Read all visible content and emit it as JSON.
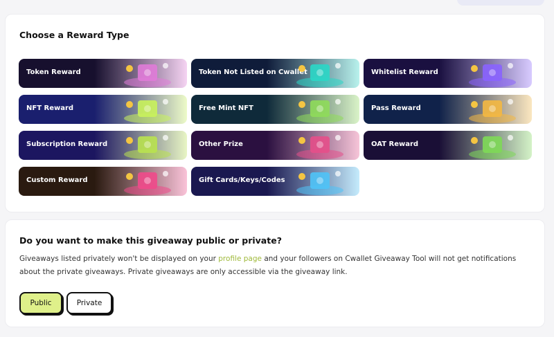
{
  "reward_section": {
    "title": "Choose a Reward Type",
    "tiles": [
      {
        "label": "Token Reward",
        "bg": "#17102e",
        "accent": "#e07bd8",
        "icon": "wallet-coins-icon"
      },
      {
        "label": "Token Not Listed on Cwallet",
        "bg": "#0f1c3a",
        "accent": "#2ad7c7",
        "icon": "coin-pedestal-icon"
      },
      {
        "label": "Whitelist Reward",
        "bg": "#1a1040",
        "accent": "#8a63ff",
        "icon": "astronaut-screen-icon"
      },
      {
        "label": "NFT Reward",
        "bg": "#1a1f6e",
        "accent": "#c9f25b",
        "icon": "nft-frame-icon"
      },
      {
        "label": "Free Mint NFT",
        "bg": "#0f2a3a",
        "accent": "#8fdc5a",
        "icon": "mint-coin-icon"
      },
      {
        "label": "Pass Reward",
        "bg": "#10224a",
        "accent": "#f4b841",
        "icon": "gift-box-icon"
      },
      {
        "label": "Subscription Reward",
        "bg": "#1c1660",
        "accent": "#b9e24f",
        "icon": "subscription-coins-icon"
      },
      {
        "label": "Other Prize",
        "bg": "#2b1040",
        "accent": "#e54f8a",
        "icon": "prize-box-icon"
      },
      {
        "label": "OAT Reward",
        "bg": "#1a0f36",
        "accent": "#7ed957",
        "icon": "oat-badge-icon"
      },
      {
        "label": "Custom Reward",
        "bg": "#2a1a10",
        "accent": "#ef4a8b",
        "icon": "custom-gift-icon"
      },
      {
        "label": "Gift Cards/Keys/Codes",
        "bg": "#1a1850",
        "accent": "#4fc3f7",
        "icon": "gift-cards-icon"
      }
    ]
  },
  "privacy_section": {
    "title": "Do you want to make this giveaway public or private?",
    "desc_before": "Giveaways listed privately won't be displayed on your ",
    "desc_link": "profile page",
    "desc_after": " and your followers on Cwallet Giveaway Tool will not get notifications about the private giveaways. Private giveaways are only accessible via the giveaway link.",
    "options": [
      {
        "label": "Public",
        "selected": true
      },
      {
        "label": "Private",
        "selected": false
      }
    ]
  }
}
